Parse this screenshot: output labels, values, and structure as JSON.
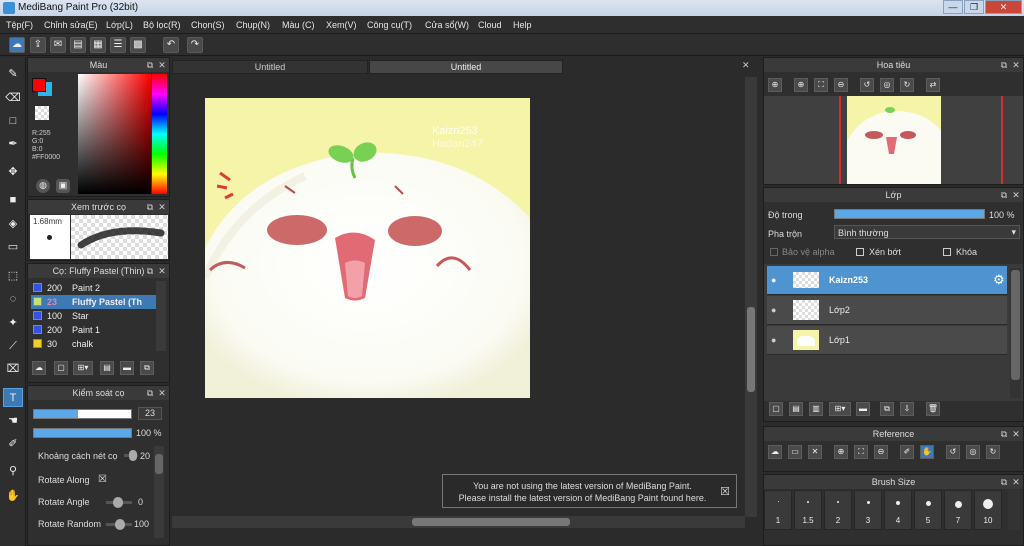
{
  "window": {
    "title": "MediBang Paint Pro (32bit)"
  },
  "menu": [
    "Tệp(F)",
    "Chỉnh sửa(E)",
    "Lớp(L)",
    "Bộ lọc(R)",
    "Chọn(S)",
    "Chụp(N)",
    "Màu (C)",
    "Xem(V)",
    "Công cụ(T)",
    "Cửa sổ(W)",
    "Cloud",
    "Help"
  ],
  "tabs": [
    "Untitled",
    "Untitled"
  ],
  "color_panel": {
    "title": "Màu",
    "r": "R:255",
    "g": "G:0",
    "b": "B:0",
    "hex": "#FF0000",
    "fg": "#ff0000",
    "bg": "#29b6e8"
  },
  "preview_panel": {
    "title": "Xem trước cọ",
    "size": "1.68mm"
  },
  "brush_panel": {
    "title": "Cọ: Fluffy Pastel (Thin)",
    "items": [
      {
        "size": "200",
        "name": "Paint 2",
        "color": "#3355dd"
      },
      {
        "size": "23",
        "name": "Fluffy Pastel (Th",
        "color": "#c8e070"
      },
      {
        "size": "100",
        "name": "Star",
        "color": "#3355dd"
      },
      {
        "size": "200",
        "name": "Paint 1",
        "color": "#3355dd"
      },
      {
        "size": "30",
        "name": "chalk",
        "color": "#f0d020"
      }
    ]
  },
  "control_panel": {
    "title": "Kiểm soát cọ",
    "size_value": "23",
    "opacity_value": "100 %",
    "spacing_label": "Khoảng cách nét cọ",
    "spacing_value": "20",
    "rotate_along": "Rotate Along",
    "rotate_along_mark": "☒",
    "rotate_angle": "Rotate Angle",
    "rotate_angle_value": "0",
    "rotate_random": "Rotate Random",
    "rotate_random_value": "100",
    "size_fill": 0.45,
    "opacity_fill": 1.0,
    "spacing_fill": 0.9,
    "rotate_angle_fill": 0.45,
    "rotate_random_fill": 0.55
  },
  "artwork": {
    "watermark1": "Kaizn253",
    "watermark2": "Hadan247"
  },
  "notice": {
    "line1": "You are not using the latest version of MediBang Paint.",
    "line2": "Please install the latest version of MediBang Paint found here.",
    "close": "☒"
  },
  "navigator": {
    "title": "Hoa tiêu"
  },
  "layers_panel": {
    "title": "Lớp",
    "opacity_label": "Độ trong",
    "opacity_value": "100 %",
    "blend_label": "Pha trộn",
    "blend_value": "Bình thường",
    "protect_alpha": "Bảo vệ alpha",
    "clipping": "Xén bớt",
    "lock": "Khóa",
    "opacity_fill": 1.0,
    "layers": [
      {
        "name": "Kaizn253",
        "selected": true
      },
      {
        "name": "Lớp2",
        "selected": false
      },
      {
        "name": "Lớp1",
        "selected": false
      }
    ]
  },
  "reference_panel": {
    "title": "Reference"
  },
  "brushsize_panel": {
    "title": "Brush Size",
    "sizes": [
      "1",
      "1.5",
      "2",
      "3",
      "4",
      "5",
      "7",
      "10"
    ]
  }
}
